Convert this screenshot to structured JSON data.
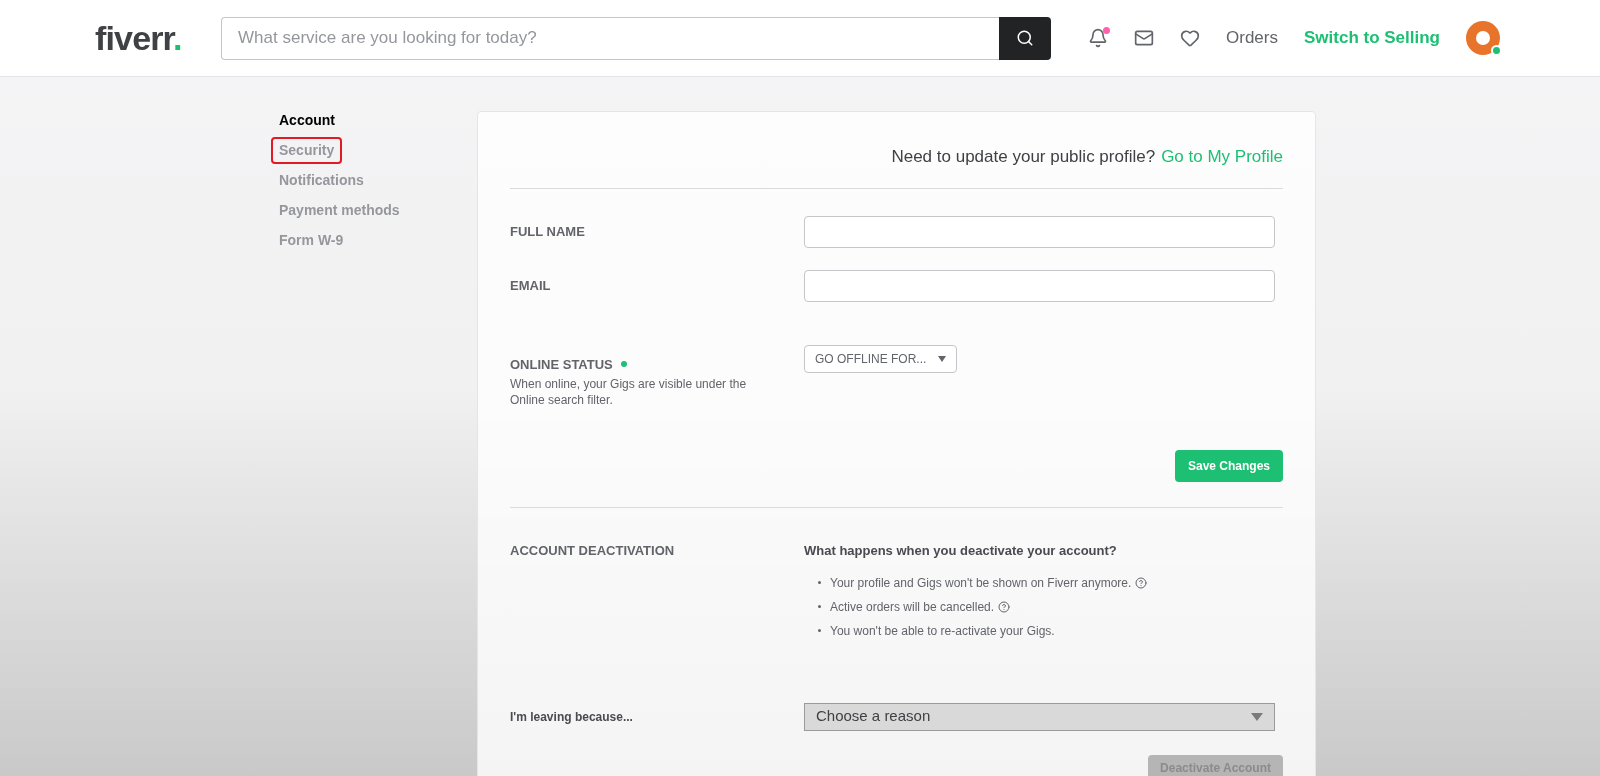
{
  "header": {
    "logo": {
      "name": "fiverr",
      "dot": "."
    },
    "search": {
      "placeholder": "What service are you looking for today?"
    },
    "notification_unread": true,
    "links": [
      {
        "label": "Orders",
        "kind": "plain"
      },
      {
        "label": "Switch to Selling",
        "kind": "accent"
      }
    ],
    "avatar_online": true
  },
  "sidebar": {
    "items": [
      {
        "label": "Account",
        "selected": true,
        "annotated": false
      },
      {
        "label": "Security",
        "selected": false,
        "annotated": true
      },
      {
        "label": "Notifications",
        "selected": false,
        "annotated": false
      },
      {
        "label": "Payment methods",
        "selected": false,
        "annotated": false
      },
      {
        "label": "Form W-9",
        "selected": false,
        "annotated": false
      }
    ]
  },
  "profile_prompt": {
    "text": "Need to update your public profile?",
    "link": "Go to My Profile"
  },
  "fields": [
    {
      "label": "FULL NAME"
    },
    {
      "label": "EMAIL"
    }
  ],
  "online_status": {
    "label": "ONLINE STATUS",
    "online": true,
    "hint": "When online, your Gigs are visible under the Online search filter.",
    "dropdown": "GO OFFLINE FOR..."
  },
  "save_button": "Save Changes",
  "deactivation": {
    "label": "ACCOUNT DEACTIVATION",
    "question": "What happens when you deactivate your account?",
    "bullets": [
      {
        "text": "Your profile and Gigs won't be shown on Fiverr anymore.",
        "help": true
      },
      {
        "text": "Active orders will be cancelled.",
        "help": true
      },
      {
        "text": "You won't be able to re-activate your Gigs.",
        "help": false
      }
    ],
    "reason_label": "I'm leaving because...",
    "reason_placeholder": "Choose a reason",
    "button": "Deactivate Account",
    "button_disabled": true
  }
}
